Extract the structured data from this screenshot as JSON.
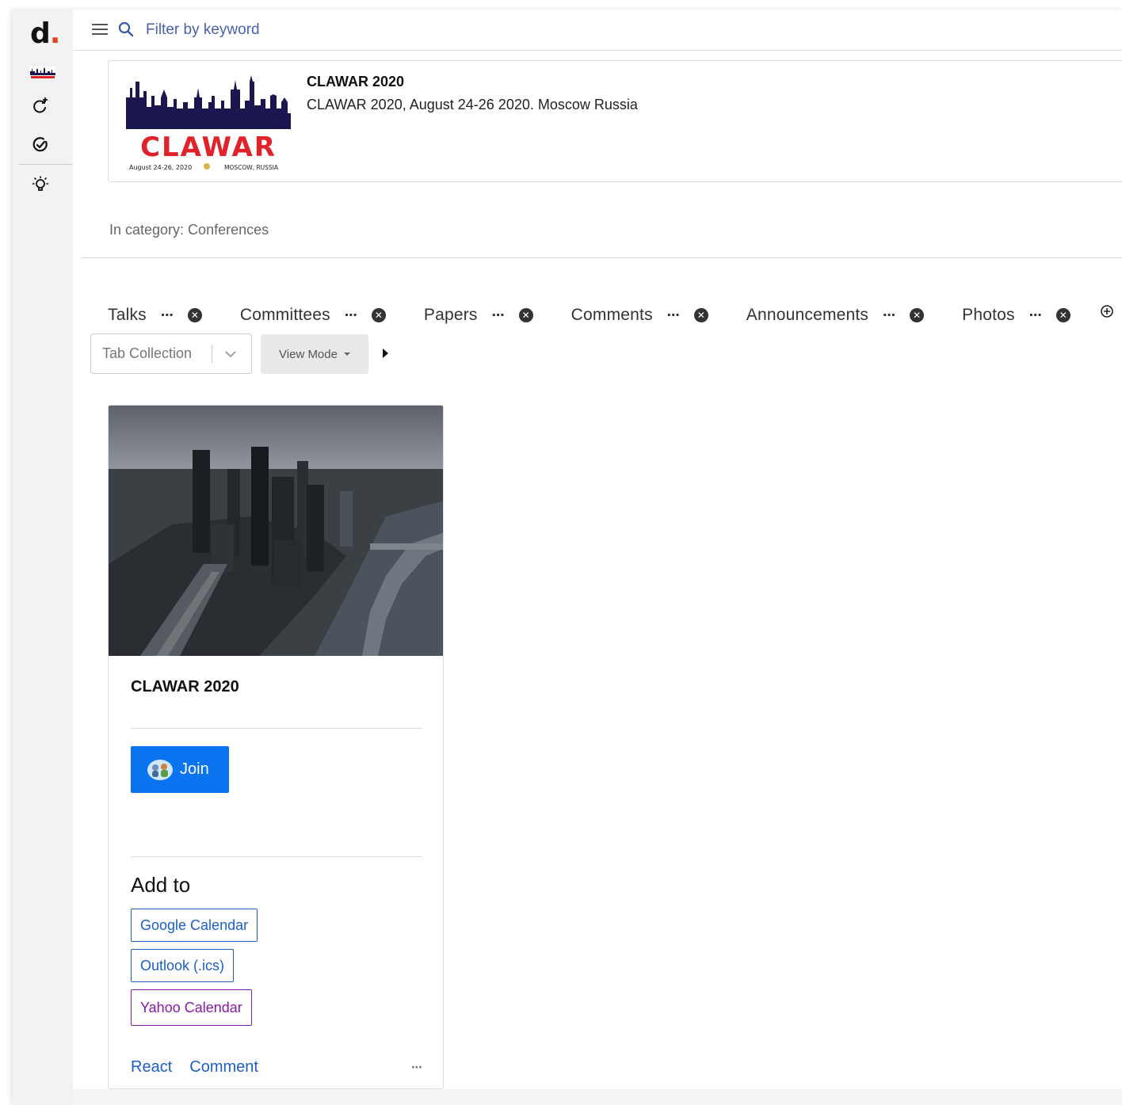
{
  "app": {
    "logo_letter": "d",
    "logo_dot": "."
  },
  "topbar": {
    "search_placeholder": "Filter by keyword"
  },
  "header": {
    "title": "CLAWAR 2020",
    "description": "CLAWAR 2020, August 24-26 2020. Moscow Russia",
    "logo": {
      "word": "CLAWAR",
      "dates": "August 24-26, 2020",
      "location": "MOSCOW, RUSSIA"
    }
  },
  "category": "In category: Conferences",
  "tabs": [
    {
      "label": "Talks",
      "more": "⋯",
      "close": "✕",
      "active": true
    },
    {
      "label": "Committees",
      "more": "⋯",
      "close": "✕"
    },
    {
      "label": "Papers",
      "more": "⋯",
      "close": "✕"
    },
    {
      "label": "Comments",
      "more": "⋯",
      "close": "✕"
    },
    {
      "label": "Announcements",
      "more": "⋯",
      "close": "✕"
    },
    {
      "label": "Photos",
      "more": "⋯",
      "close": "✕"
    }
  ],
  "controls": {
    "tab_collection_label": "Tab Collection",
    "view_mode_label": "View Mode"
  },
  "event_card": {
    "title": "CLAWAR 2020",
    "join_label": "Join",
    "add_to_label": "Add to",
    "calendars": [
      "Google Calendar",
      "Outlook (.ics)",
      "Yahoo Calendar"
    ],
    "footer": {
      "react": "React",
      "comment": "Comment",
      "more": "⋯"
    }
  },
  "colors": {
    "accent": "#e0441d",
    "join_blue": "#0a74f0",
    "link_blue": "#1d5fc4",
    "yahoo_purple": "#8a1aaa",
    "logo_navy": "#1a1650",
    "logo_red": "#e0222b"
  },
  "icons": [
    "menu-icon",
    "search-icon",
    "refresh-plus-icon",
    "check-circle-icon",
    "lightbulb-icon",
    "close-icon",
    "add-circle-icon",
    "chevron-down-icon",
    "play-icon"
  ]
}
